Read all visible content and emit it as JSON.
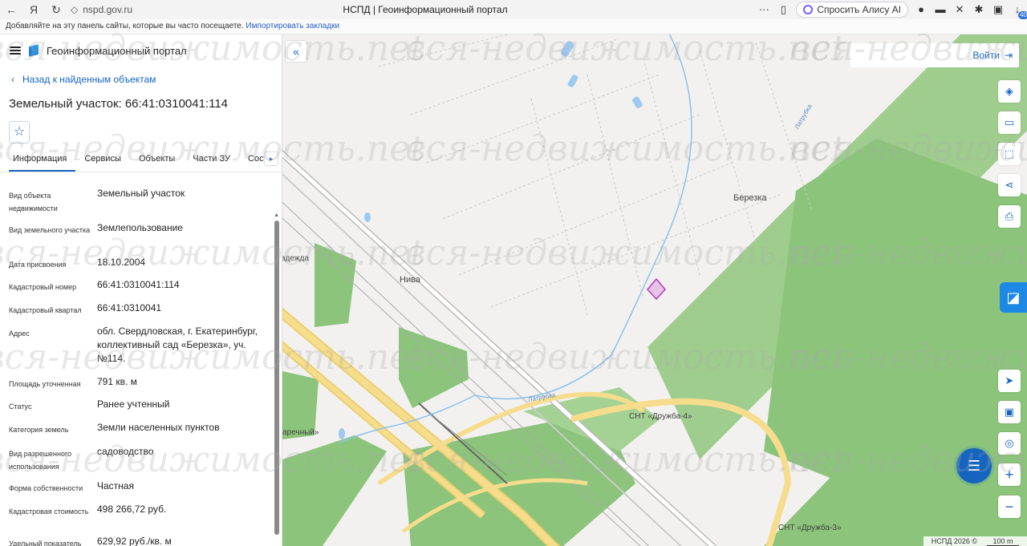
{
  "browser": {
    "url": "nspd.gov.ru",
    "title": "НСПД | Геоинформационный портал",
    "alice_label": "Спросить Алису AI",
    "ext_badge": "40",
    "bookmarks_prompt": "Добавляйте на эту панель сайты, которые вы часто посещаете.",
    "bookmarks_import": "Импортировать закладки"
  },
  "panel": {
    "portal_name": "Геоинформационный портал",
    "back_label": "Назад к найденным объектам",
    "title": "Земельный участок: 66:41:0310041:114",
    "tabs": [
      "Информация",
      "Сервисы",
      "Объекты",
      "Части ЗУ",
      "Состав"
    ],
    "props": [
      {
        "key": "Вид объекта недвижимости",
        "value": "Земельный участок"
      },
      {
        "key": "Вид земельного участка",
        "value": "Землепользование"
      },
      {
        "key": "Дата присвоения",
        "value": "18.10.2004"
      },
      {
        "key": "Кадастровый номер",
        "value": "66:41:0310041:114"
      },
      {
        "key": "Кадастровый квартал",
        "value": "66:41:0310041"
      },
      {
        "key": "Адрес",
        "value": "обл. Свердловская, г. Екатеринбург, коллективный сад «Березка», уч. №114."
      },
      {
        "key": "Площадь уточненная",
        "value": "791 кв. м"
      },
      {
        "key": "Статус",
        "value": "Ранее учтенный"
      },
      {
        "key": "Категория земель",
        "value": "Земли населенных пунктов"
      },
      {
        "key": "Вид разрешенного использования",
        "value": "садоводство"
      },
      {
        "key": "Форма собственности",
        "value": "Частная"
      },
      {
        "key": "Кадастровая стоимость",
        "value": "498 266,72 руб."
      },
      {
        "key": "Удельный показатель",
        "value": "629,92 руб./кв. м"
      }
    ]
  },
  "map": {
    "login_label": "Войти",
    "labels": {
      "bereska": "Березка",
      "niva": "Нива",
      "nadezhda": "адежда",
      "snt4": "СНТ «Дружба-4»",
      "snt3": "СНТ «Дружба-3»",
      "zarechny": "аречный»",
      "latr1": "Латрубка",
      "latr2": "Латрубка"
    },
    "attribution": "НСПД 2026 ©",
    "scale": "100 m",
    "watermark": "вся-недвижимость.net"
  },
  "colors": {
    "accent": "#1565c0",
    "green": "#8bc47a",
    "road": "#f0d98a",
    "parcel": "#b03fb8"
  }
}
